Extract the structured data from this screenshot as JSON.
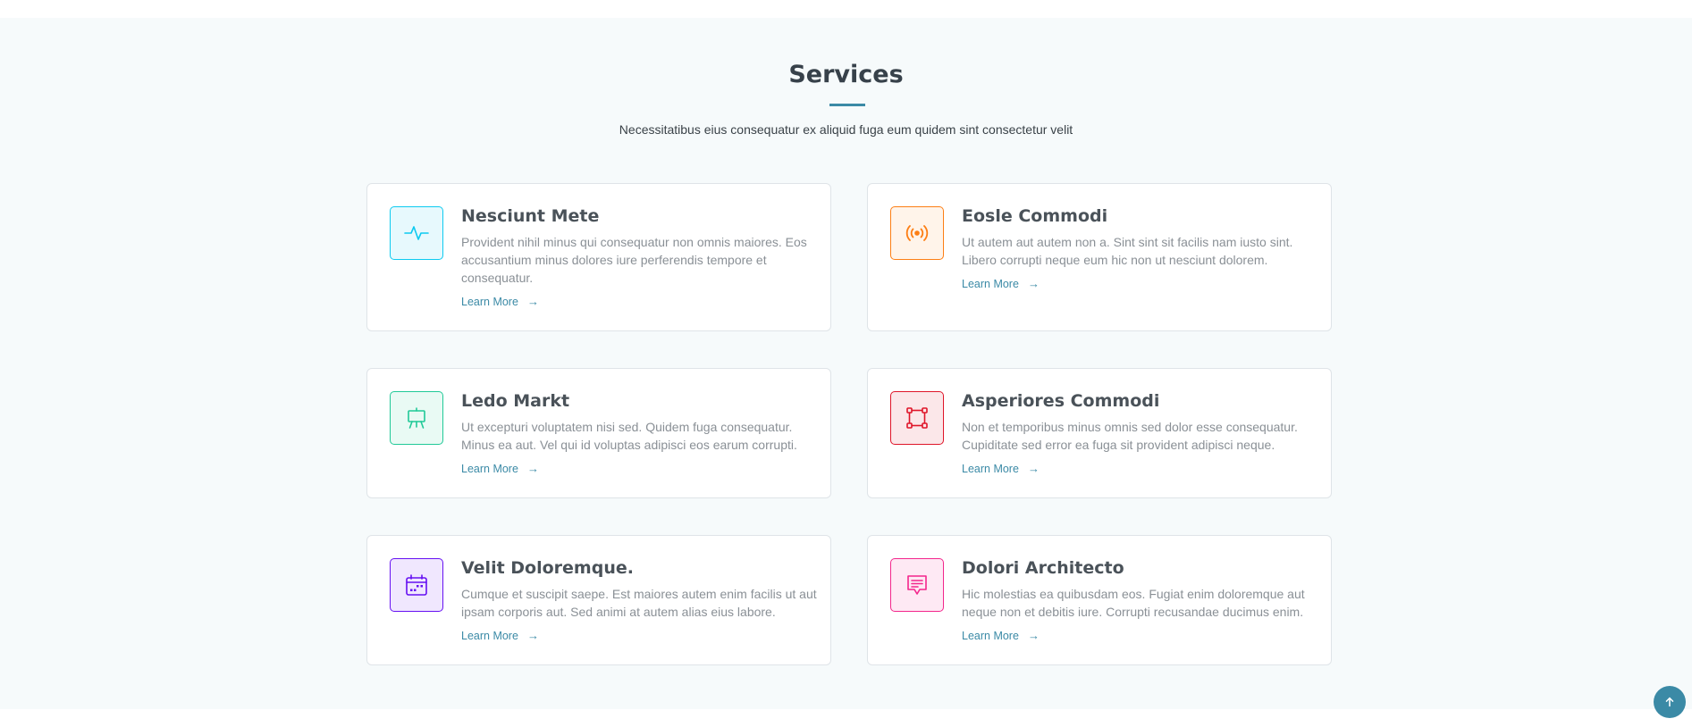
{
  "header": {
    "title": "Services",
    "subtitle": "Necessitatibus eius consequatur ex aliquid fuga eum quidem sint consectetur velit"
  },
  "services": [
    {
      "title": "Nesciunt Mete",
      "description": "Provident nihil minus qui consequatur non omnis maiores. Eos accusantium minus dolores iure perferendis tempore et consequatur.",
      "link": "Learn More",
      "icon": "activity-icon",
      "color": "#0dcaf0",
      "bg": "#e7f9fd"
    },
    {
      "title": "Eosle Commodi",
      "description": "Ut autem aut autem non a. Sint sint sit facilis nam iusto sint. Libero corrupti neque eum hic non ut nesciunt dolorem.",
      "link": "Learn More",
      "icon": "broadcast-icon",
      "color": "#fd7e14",
      "bg": "#fff4ea"
    },
    {
      "title": "Ledo Markt",
      "description": "Ut excepturi voluptatem nisi sed. Quidem fuga consequatur. Minus ea aut. Vel qui id voluptas adipisci eos earum corrupti.",
      "link": "Learn More",
      "icon": "easel-icon",
      "color": "#20c997",
      "bg": "#e9faf4"
    },
    {
      "title": "Asperiores Commodi",
      "description": "Non et temporibus minus omnis sed dolor esse consequatur. Cupiditate sed error ea fuga sit provident adipisci neque.",
      "link": "Learn More",
      "icon": "bounding-box-icon",
      "color": "#df1529",
      "bg": "#fbe7e9"
    },
    {
      "title": "Velit Doloremque.",
      "description": "Cumque et suscipit saepe. Est maiores autem enim facilis ut aut ipsam corporis aut. Sed animi at autem alias eius labore.",
      "link": "Learn More",
      "icon": "calendar-icon",
      "color": "#6610f2",
      "bg": "#f0e7fe"
    },
    {
      "title": "Dolori Architecto",
      "description": "Hic molestias ea quibusdam eos. Fugiat enim doloremque aut neque non et debitis iure. Corrupti recusandae ducimus enim.",
      "link": "Learn More",
      "icon": "chat-text-icon",
      "color": "#f3268c",
      "bg": "#fee9f4"
    }
  ],
  "scroll_top": {
    "icon": "arrow-up-icon"
  }
}
